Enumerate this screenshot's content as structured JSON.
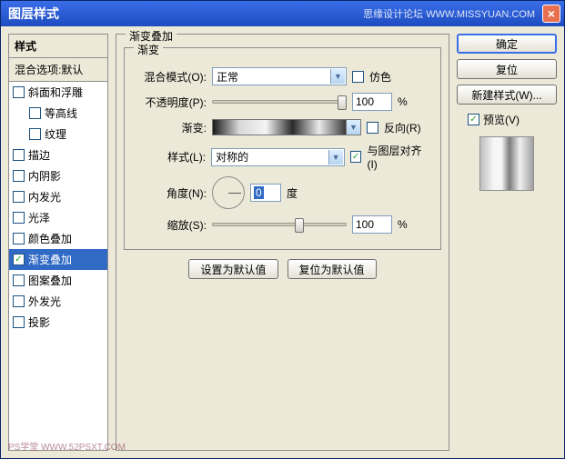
{
  "window": {
    "title": "图层样式",
    "watermark": "思缘设计论坛  WWW.MISSYUAN.COM",
    "close_icon": "×"
  },
  "sidebar": {
    "header": "样式",
    "sub": "混合选项:默认",
    "items": [
      {
        "label": "斜面和浮雕",
        "checked": false,
        "indent": false,
        "selected": false
      },
      {
        "label": "等高线",
        "checked": false,
        "indent": true,
        "selected": false
      },
      {
        "label": "纹理",
        "checked": false,
        "indent": true,
        "selected": false
      },
      {
        "label": "描边",
        "checked": false,
        "indent": false,
        "selected": false
      },
      {
        "label": "内阴影",
        "checked": false,
        "indent": false,
        "selected": false
      },
      {
        "label": "内发光",
        "checked": false,
        "indent": false,
        "selected": false
      },
      {
        "label": "光泽",
        "checked": false,
        "indent": false,
        "selected": false
      },
      {
        "label": "颜色叠加",
        "checked": false,
        "indent": false,
        "selected": false
      },
      {
        "label": "渐变叠加",
        "checked": true,
        "indent": false,
        "selected": true
      },
      {
        "label": "图案叠加",
        "checked": false,
        "indent": false,
        "selected": false
      },
      {
        "label": "外发光",
        "checked": false,
        "indent": false,
        "selected": false
      },
      {
        "label": "投影",
        "checked": false,
        "indent": false,
        "selected": false
      }
    ]
  },
  "center": {
    "group_title": "渐变叠加",
    "inner_title": "渐变",
    "blend_mode_label": "混合模式(O):",
    "blend_mode_value": "正常",
    "dither_label": "仿色",
    "dither_checked": false,
    "opacity_label": "不透明度(P):",
    "opacity_value": "100",
    "opacity_unit": "%",
    "gradient_label": "渐变:",
    "reverse_label": "反向(R)",
    "reverse_checked": false,
    "style_label": "样式(L):",
    "style_value": "对称的",
    "align_label": "与图层对齐(I)",
    "align_checked": true,
    "angle_label": "角度(N):",
    "angle_value": "0",
    "angle_unit": "度",
    "scale_label": "缩放(S):",
    "scale_value": "100",
    "scale_unit": "%",
    "btn_default": "设置为默认值",
    "btn_reset": "复位为默认值"
  },
  "right": {
    "ok": "确定",
    "cancel": "复位",
    "new_style": "新建样式(W)...",
    "preview_label": "预览(V)",
    "preview_checked": true
  },
  "footer_wm": "PS学堂  WWW.52PSXT.COM"
}
